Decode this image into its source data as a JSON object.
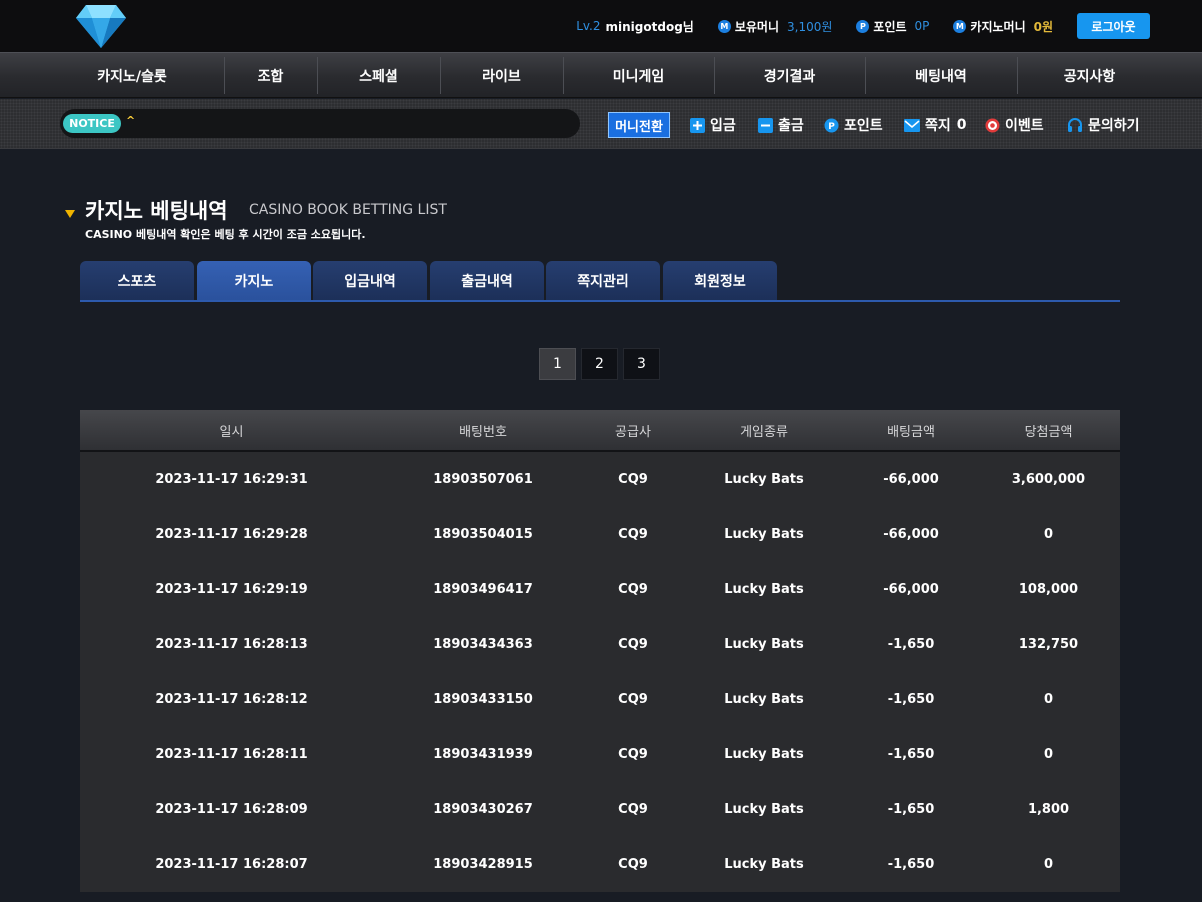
{
  "header": {
    "level": "Lv.2",
    "username": "minigotdog님",
    "balance": {
      "icon": "M",
      "label": "보유머니",
      "value": "3,100원"
    },
    "point": {
      "icon": "P",
      "label": "포인트",
      "value": "0P"
    },
    "casino_money": {
      "icon": "M",
      "label": "카지노머니",
      "value": "0원"
    },
    "logout_label": "로그아웃"
  },
  "nav": {
    "items": [
      {
        "label": "카지노/슬롯"
      },
      {
        "label": "조합"
      },
      {
        "label": "스페셜"
      },
      {
        "label": "라이브"
      },
      {
        "label": "미니게임"
      },
      {
        "label": "경기결과"
      },
      {
        "label": "베팅내역"
      },
      {
        "label": "공지사항"
      }
    ]
  },
  "notice": {
    "badge": "NOTICE",
    "text": "^"
  },
  "quickmenu": {
    "money_switch": "머니전환",
    "deposit": "입금",
    "withdraw": "출금",
    "point": "포인트",
    "message": "쪽지",
    "message_count": "0",
    "event": "이벤트",
    "inquiry": "문의하기"
  },
  "page": {
    "title": "카지노 베팅내역",
    "subtitle": "CASINO BOOK BETTING LIST",
    "note": "CASINO 베팅내역 확인은 베팅 후 시간이 조금 소요됩니다."
  },
  "tabs": [
    {
      "label": "스포츠",
      "active": false
    },
    {
      "label": "카지노",
      "active": true
    },
    {
      "label": "입금내역",
      "active": false
    },
    {
      "label": "출금내역",
      "active": false
    },
    {
      "label": "쪽지관리",
      "active": false
    },
    {
      "label": "회원정보",
      "active": false
    }
  ],
  "pagination": {
    "pages": [
      "1",
      "2",
      "3"
    ],
    "current": "1"
  },
  "table": {
    "headers": [
      "일시",
      "배팅번호",
      "공급사",
      "게임종류",
      "배팅금액",
      "당첨금액"
    ],
    "rows": [
      [
        "2023-11-17 16:29:31",
        "18903507061",
        "CQ9",
        "Lucky Bats",
        "-66,000",
        "3,600,000"
      ],
      [
        "2023-11-17 16:29:28",
        "18903504015",
        "CQ9",
        "Lucky Bats",
        "-66,000",
        "0"
      ],
      [
        "2023-11-17 16:29:19",
        "18903496417",
        "CQ9",
        "Lucky Bats",
        "-66,000",
        "108,000"
      ],
      [
        "2023-11-17 16:28:13",
        "18903434363",
        "CQ9",
        "Lucky Bats",
        "-1,650",
        "132,750"
      ],
      [
        "2023-11-17 16:28:12",
        "18903433150",
        "CQ9",
        "Lucky Bats",
        "-1,650",
        "0"
      ],
      [
        "2023-11-17 16:28:11",
        "18903431939",
        "CQ9",
        "Lucky Bats",
        "-1,650",
        "0"
      ],
      [
        "2023-11-17 16:28:09",
        "18903430267",
        "CQ9",
        "Lucky Bats",
        "-1,650",
        "1,800"
      ],
      [
        "2023-11-17 16:28:07",
        "18903428915",
        "CQ9",
        "Lucky Bats",
        "-1,650",
        "0"
      ]
    ]
  },
  "colors": {
    "accent_blue": "#1796ef",
    "gold": "#e3b93a",
    "tab_active": "#2a519c",
    "notice_badge": "#3cc6c4"
  }
}
